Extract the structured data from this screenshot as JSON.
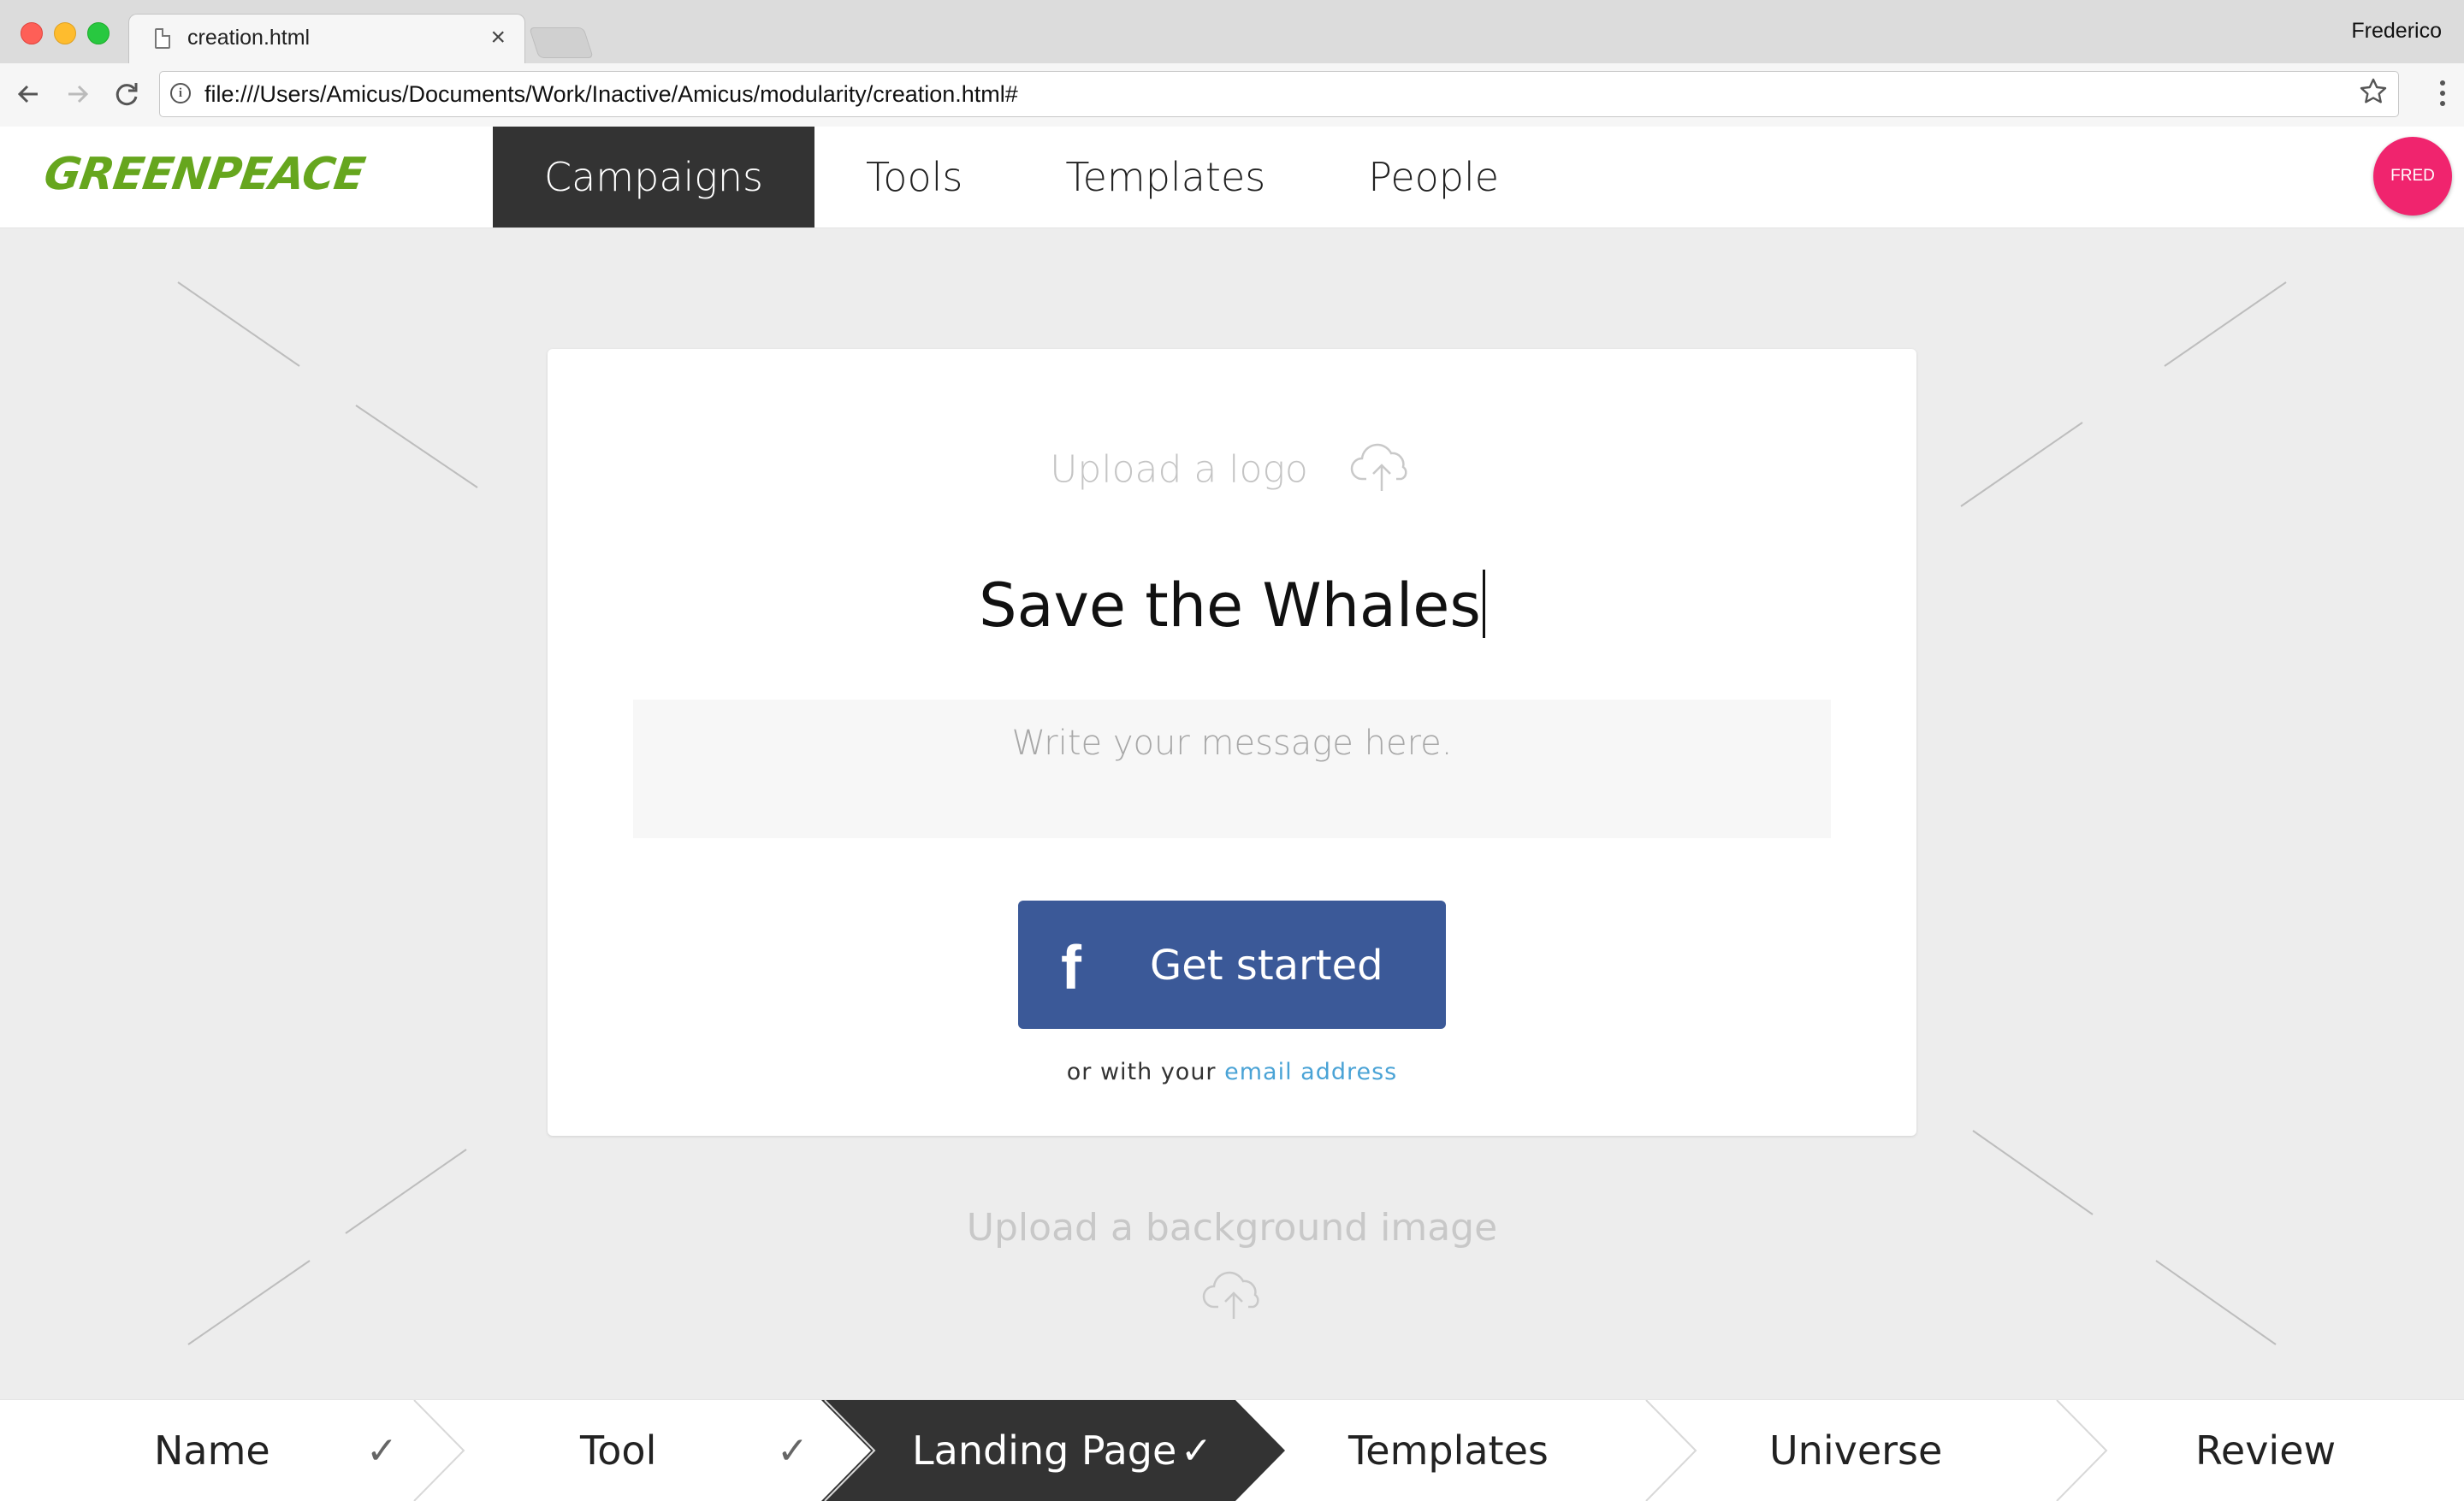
{
  "browser": {
    "tab_title": "creation.html",
    "tab_close": "×",
    "profile_name": "Frederico",
    "url": "file:///Users/Amicus/Documents/Work/Inactive/Amicus/modularity/creation.html#",
    "back_icon": "arrow-left-icon",
    "forward_icon": "arrow-right-icon",
    "reload_icon": "reload-icon",
    "bookmark_icon": "star-icon",
    "menu_icon": "kebab-menu-icon"
  },
  "header": {
    "logo_text": "GREENPEACE",
    "nav": [
      {
        "label": "Campaigns",
        "active": true
      },
      {
        "label": "Tools",
        "active": false
      },
      {
        "label": "Templates",
        "active": false
      },
      {
        "label": "People",
        "active": false
      }
    ],
    "avatar_label": "FRED"
  },
  "card": {
    "upload_logo_label": "Upload a logo",
    "title": "Save the Whales",
    "message_placeholder": "Write your message here.",
    "button_icon": "f",
    "button_label": "Get started",
    "alt_prefix": "or with your",
    "alt_link": "email address"
  },
  "background": {
    "upload_label": "Upload a background image"
  },
  "steps": [
    {
      "label": "Name",
      "done": true,
      "active": false
    },
    {
      "label": "Tool",
      "done": true,
      "active": false
    },
    {
      "label": "Landing Page",
      "done": true,
      "active": true
    },
    {
      "label": "Templates",
      "done": false,
      "active": false
    },
    {
      "label": "Universe",
      "done": false,
      "active": false
    },
    {
      "label": "Review",
      "done": false,
      "active": false
    }
  ],
  "checkmark": "✓",
  "colors": {
    "brand_green": "#66a61e",
    "nav_active_bg": "#333333",
    "avatar_pink": "#f0246e",
    "facebook_blue": "#3b5998",
    "link_blue": "#4aa3d6"
  }
}
